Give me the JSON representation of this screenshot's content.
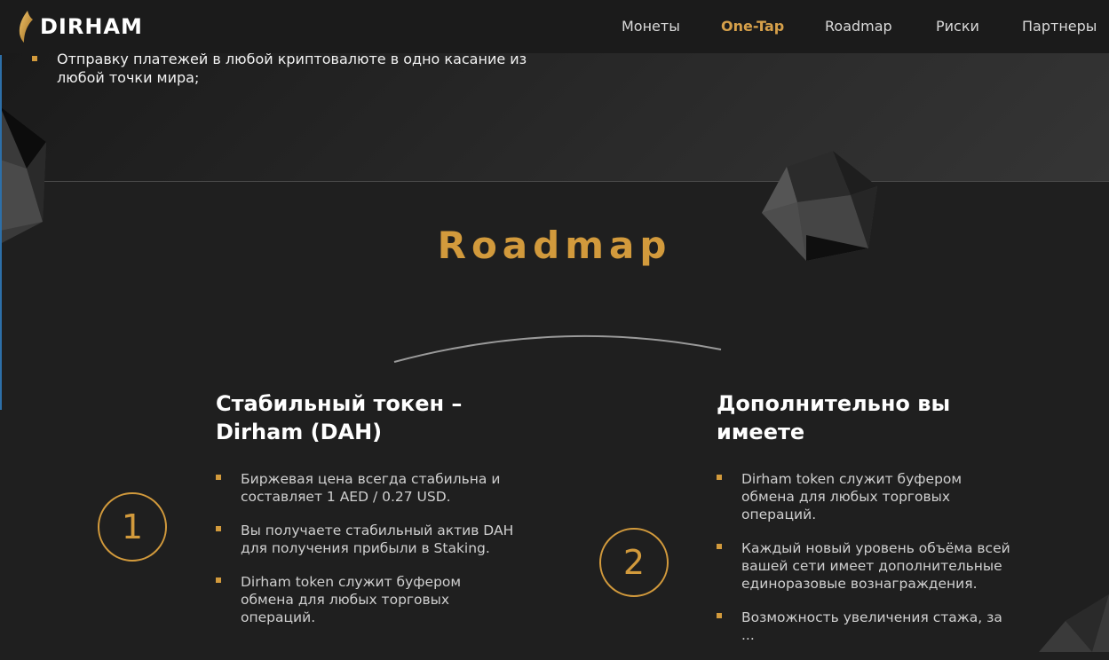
{
  "header": {
    "logo_text": "DIRHAM",
    "nav": [
      {
        "label": "Монеты"
      },
      {
        "label": "One-Tap"
      },
      {
        "label": "Roadmap"
      },
      {
        "label": "Риски"
      },
      {
        "label": "Партнеры"
      }
    ],
    "active_nav": "One-Tap"
  },
  "hero": {
    "bullet": "Отправку платежей в любой криптовалюте в одно касание из любой точки мира;"
  },
  "roadmap": {
    "title": "Roadmap",
    "columns": [
      {
        "number": "1",
        "title": "Стабильный токен – Dirham (DAH)",
        "bullets": [
          "Биржевая цена всегда стабильна и составляет 1 AED / 0.27 USD.",
          "Вы получаете стабильный актив DAH для получения прибыли в Staking.",
          "Dirham token служит буфером обмена для любых торговых операций."
        ]
      },
      {
        "number": "2",
        "title": "Дополнительно вы имеете",
        "bullets": [
          "Dirham token служит буфером обмена для любых торговых операций.",
          "Каждый новый уровень объёма всей вашей сети имеет дополнительные единоразовые вознаграждения.",
          "Возможность увеличения стажа, за ..."
        ]
      }
    ]
  },
  "colors": {
    "accent": "#d29a3c",
    "background": "#1f1f1f",
    "header": "#1b1b1b"
  }
}
